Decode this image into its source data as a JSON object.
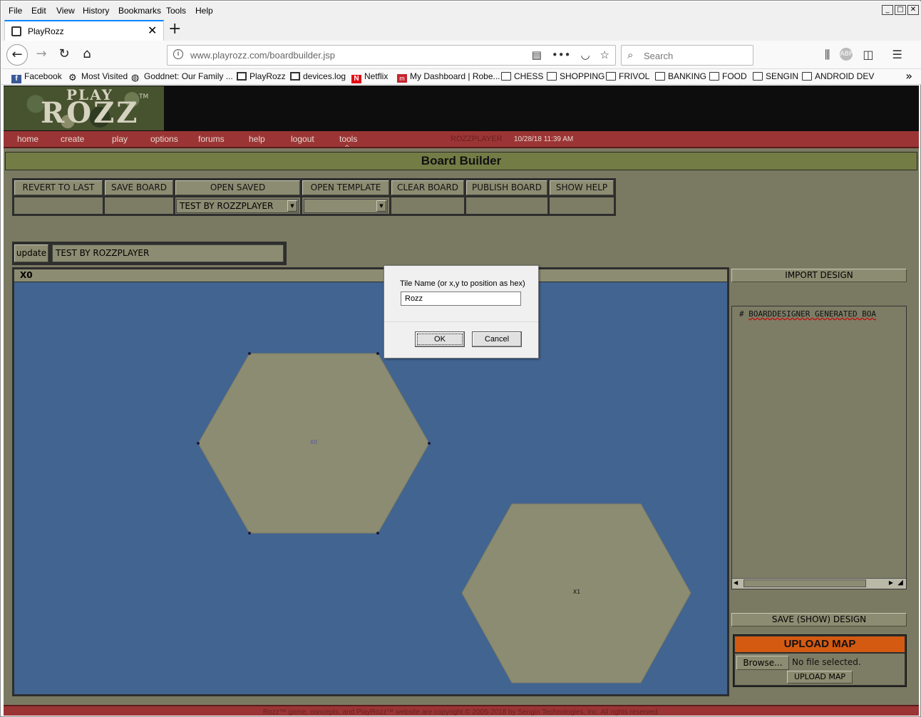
{
  "menubar": {
    "items": [
      "File",
      "Edit",
      "View",
      "History",
      "Bookmarks",
      "Tools",
      "Help"
    ],
    "window_controls": [
      "_",
      "□",
      "✕"
    ]
  },
  "tab": {
    "title": "PlayRozz",
    "close": "✕",
    "new_tab": "+"
  },
  "navbar": {
    "url_domain": "www.playrozz.com",
    "url_path": "/boardbuilder.jsp",
    "search_placeholder": "Search",
    "url_icons": [
      "reader-view-icon",
      "page-actions-icon",
      "pocket-icon",
      "bookmark-star-icon"
    ]
  },
  "bookmarks": [
    {
      "label": "Facebook",
      "icon": "facebook-icon"
    },
    {
      "label": "Most Visited",
      "icon": "gear-icon"
    },
    {
      "label": "Goddnet: Our Family ...",
      "icon": "globe-icon"
    },
    {
      "label": "PlayRozz",
      "icon": "playrozz-icon"
    },
    {
      "label": "devices.log",
      "icon": "playrozz-icon"
    },
    {
      "label": "Netflix",
      "icon": "netflix-icon"
    },
    {
      "label": "My Dashboard | Robe...",
      "icon": "dashboard-icon"
    },
    {
      "label": "CHESS",
      "icon": "folder-icon"
    },
    {
      "label": "SHOPPING",
      "icon": "folder-icon"
    },
    {
      "label": "FRIVOL",
      "icon": "folder-icon"
    },
    {
      "label": "BANKING",
      "icon": "folder-icon"
    },
    {
      "label": "FOOD",
      "icon": "folder-icon"
    },
    {
      "label": "SENGIN",
      "icon": "folder-icon"
    },
    {
      "label": "ANDROID DEV",
      "icon": "folder-icon"
    }
  ],
  "site": {
    "logo_play": "PLAY",
    "logo_rozz": "ROZZ",
    "logo_tm": "TM",
    "nav": [
      "home",
      "create",
      "play",
      "options",
      "forums",
      "help",
      "logout",
      "tools"
    ],
    "user": "ROZZPLAYER",
    "datetime": "10/28/18 11:39 AM",
    "page_title": "Board Builder"
  },
  "toolbar": {
    "buttons": [
      "REVERT TO LAST",
      "SAVE BOARD",
      "OPEN SAVED",
      "OPEN TEMPLATE",
      "CLEAR BOARD",
      "PUBLISH BOARD",
      "SHOW HELP"
    ],
    "open_saved_value": "TEST BY ROZZPLAYER",
    "open_template_value": ""
  },
  "board": {
    "update_label": "update",
    "board_name": "TEST BY ROZZPLAYER",
    "header": "X0",
    "tiles": [
      {
        "label": "X0",
        "fill": "#8c8c72",
        "selected": true
      },
      {
        "label": "X1",
        "fill": "#8c8c72",
        "selected": false
      }
    ],
    "background": "#416491"
  },
  "side": {
    "import_label": "IMPORT DESIGN",
    "design_text_prefix": "# ",
    "design_text_main": "BOARDDESIGNER GENERATED BOA",
    "save_show_label": "SAVE (SHOW) DESIGN",
    "upload_title": "UPLOAD MAP",
    "browse_label": "Browse...",
    "no_file": "No file selected.",
    "upload_button": "UPLOAD MAP"
  },
  "footer": "Rozz™ game, concepts, and PlayRozz™ website are copyright © 2005-2018 by Sengin Technologies, Inc. All rights reserved.",
  "dialog": {
    "prompt": "Tile Name (or x,y to position as hex)",
    "value": "Rozz",
    "ok": "OK",
    "cancel": "Cancel"
  }
}
